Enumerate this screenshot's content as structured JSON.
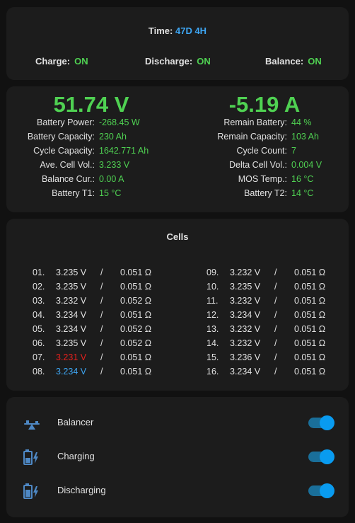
{
  "status": {
    "time_label": "Time:",
    "time_value": "47D 4H",
    "charge_label": "Charge:",
    "charge_value": "ON",
    "discharge_label": "Discharge:",
    "discharge_value": "ON",
    "balance_label": "Balance:",
    "balance_value": "ON"
  },
  "summary": {
    "voltage": "51.74 V",
    "current": "-5.19 A",
    "left": [
      {
        "label": "Battery Power:",
        "value": "-268.45 W"
      },
      {
        "label": "Battery Capacity:",
        "value": "230 Ah"
      },
      {
        "label": "Cycle Capacity:",
        "value": "1642.771 Ah"
      },
      {
        "label": "Ave. Cell Vol.:",
        "value": "3.233 V"
      },
      {
        "label": "Balance Cur.:",
        "value": "0.00 A"
      },
      {
        "label": "Battery T1:",
        "value": "15 °C"
      }
    ],
    "right": [
      {
        "label": "Remain Battery:",
        "value": "44 %"
      },
      {
        "label": "Remain Capacity:",
        "value": "103 Ah"
      },
      {
        "label": "Cycle Count:",
        "value": "7"
      },
      {
        "label": "Delta Cell Vol.:",
        "value": "0.004 V"
      },
      {
        "label": "MOS Temp.:",
        "value": "16 °C"
      },
      {
        "label": "Battery T2:",
        "value": "14 °C"
      }
    ]
  },
  "cells": {
    "title": "Cells",
    "separator": "/",
    "colors": {
      "normal": "#e1e1e1",
      "min": "#3ea7f5",
      "max": "#e3201c"
    },
    "list": [
      {
        "num": "01.",
        "voltage": "3.235 V",
        "resistance": "0.051 Ω",
        "state": "normal"
      },
      {
        "num": "02.",
        "voltage": "3.235 V",
        "resistance": "0.051 Ω",
        "state": "normal"
      },
      {
        "num": "03.",
        "voltage": "3.232 V",
        "resistance": "0.052 Ω",
        "state": "normal"
      },
      {
        "num": "04.",
        "voltage": "3.234 V",
        "resistance": "0.051 Ω",
        "state": "normal"
      },
      {
        "num": "05.",
        "voltage": "3.234 V",
        "resistance": "0.052 Ω",
        "state": "normal"
      },
      {
        "num": "06.",
        "voltage": "3.235 V",
        "resistance": "0.052 Ω",
        "state": "normal"
      },
      {
        "num": "07.",
        "voltage": "3.231 V",
        "resistance": "0.051 Ω",
        "state": "max"
      },
      {
        "num": "08.",
        "voltage": "3.234 V",
        "resistance": "0.051 Ω",
        "state": "min"
      },
      {
        "num": "09.",
        "voltage": "3.232 V",
        "resistance": "0.051 Ω",
        "state": "normal"
      },
      {
        "num": "10.",
        "voltage": "3.235 V",
        "resistance": "0.051 Ω",
        "state": "normal"
      },
      {
        "num": "11.",
        "voltage": "3.232 V",
        "resistance": "0.051 Ω",
        "state": "normal"
      },
      {
        "num": "12.",
        "voltage": "3.234 V",
        "resistance": "0.051 Ω",
        "state": "normal"
      },
      {
        "num": "13.",
        "voltage": "3.232 V",
        "resistance": "0.051 Ω",
        "state": "normal"
      },
      {
        "num": "14.",
        "voltage": "3.232 V",
        "resistance": "0.051 Ω",
        "state": "normal"
      },
      {
        "num": "15.",
        "voltage": "3.236 V",
        "resistance": "0.051 Ω",
        "state": "normal"
      },
      {
        "num": "16.",
        "voltage": "3.234 V",
        "resistance": "0.051 Ω",
        "state": "normal"
      }
    ]
  },
  "toggles": [
    {
      "label": "Balancer",
      "icon": "seesaw-icon",
      "on": true
    },
    {
      "label": "Charging",
      "icon": "battery-charging-icon",
      "on": true
    },
    {
      "label": "Discharging",
      "icon": "battery-discharging-icon",
      "on": true
    }
  ],
  "accent_colors": {
    "value_green": "#4fd152",
    "time_blue": "#3ea7f5",
    "icon_blue": "#4e88c4",
    "switch_on": "#099bf0"
  }
}
